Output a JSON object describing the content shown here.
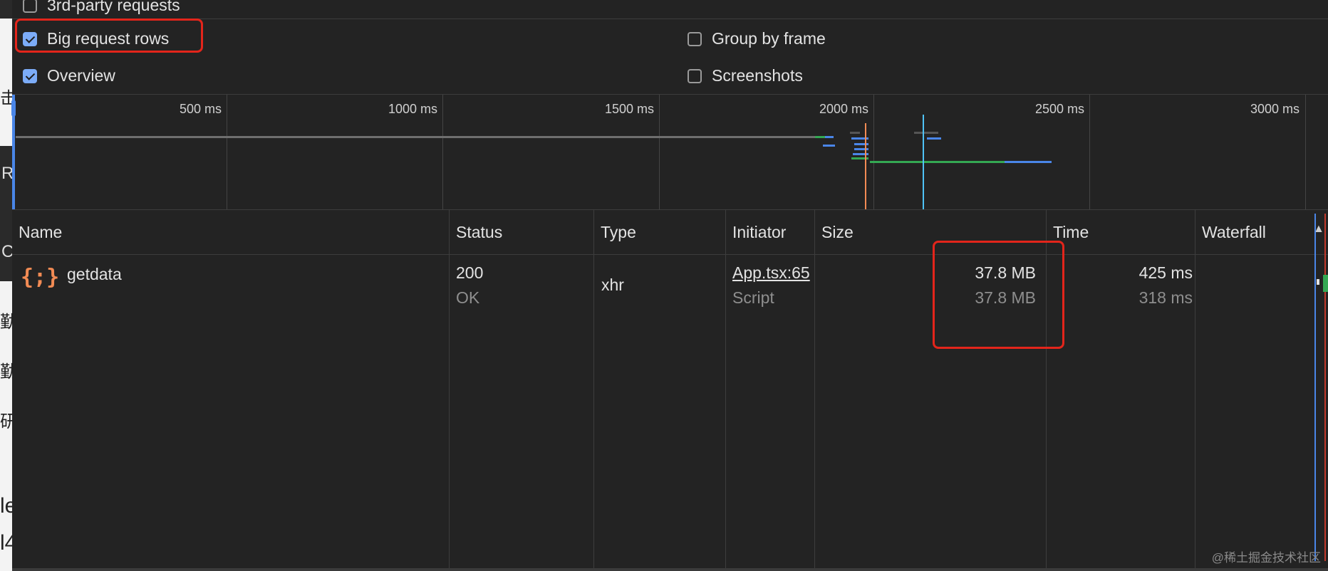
{
  "settings": {
    "third_party": {
      "label": "3rd-party requests",
      "checked": false
    },
    "big_rows": {
      "label": "Big request rows",
      "checked": true
    },
    "group_by_frame": {
      "label": "Group by frame",
      "checked": false
    },
    "overview": {
      "label": "Overview",
      "checked": true
    },
    "screenshots": {
      "label": "Screenshots",
      "checked": false
    }
  },
  "timeline": {
    "ticks": [
      "500 ms",
      "1000 ms",
      "1500 ms",
      "2000 ms",
      "2500 ms",
      "3000 ms"
    ]
  },
  "table": {
    "columns": {
      "name": "Name",
      "status": "Status",
      "type": "Type",
      "initiator": "Initiator",
      "size": "Size",
      "time": "Time",
      "waterfall": "Waterfall"
    },
    "sort_indicator": "▲",
    "rows": [
      {
        "icon": "{;}",
        "name": "getdata",
        "status": "200",
        "status_text": "OK",
        "type": "xhr",
        "initiator": "App.tsx:65",
        "initiator_type": "Script",
        "size": "37.8 MB",
        "size_resource": "37.8 MB",
        "time": "425 ms",
        "time_latency": "318 ms"
      }
    ]
  },
  "page_behind": {
    "chars": [
      "击",
      "R",
      "C",
      "勤",
      "勤",
      "研",
      "le",
      "l4"
    ]
  },
  "watermark": "@稀土掘金技术社区",
  "colors": {
    "background": "#232323",
    "checkbox_checked": "#7cacf8",
    "highlight": "#e3251b",
    "icon_orange": "#f28b54",
    "waterfall_blue": "#4a86e8",
    "waterfall_green": "#34a853"
  }
}
